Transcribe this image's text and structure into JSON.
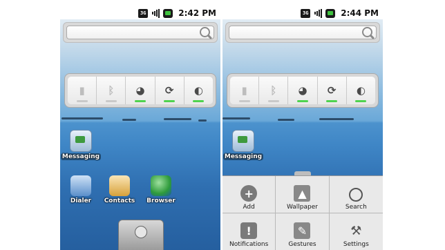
{
  "left_screen": {
    "status": {
      "network": "3G",
      "clock": "2:42 PM"
    },
    "widget": {
      "toggles": [
        {
          "icon": "wifi-toggle-icon",
          "state": "off"
        },
        {
          "icon": "bluetooth-toggle-icon",
          "state": "off"
        },
        {
          "icon": "gps-toggle-icon",
          "state": "on"
        },
        {
          "icon": "sync-toggle-icon",
          "state": "on"
        },
        {
          "icon": "brightness-toggle-icon",
          "state": "on"
        }
      ]
    },
    "shortcuts": {
      "messaging": "Messaging",
      "dialer": "Dialer",
      "contacts": "Contacts",
      "browser": "Browser"
    }
  },
  "right_screen": {
    "status": {
      "network": "3G",
      "clock": "2:44 PM"
    },
    "shortcuts": {
      "messaging": "Messaging"
    },
    "menu": {
      "items": [
        {
          "label": "Add",
          "icon": "add-icon"
        },
        {
          "label": "Wallpaper",
          "icon": "wallpaper-icon"
        },
        {
          "label": "Search",
          "icon": "search-icon"
        },
        {
          "label": "Notifications",
          "icon": "notifications-icon"
        },
        {
          "label": "Gestures",
          "icon": "gestures-icon"
        },
        {
          "label": "Settings",
          "icon": "settings-icon"
        }
      ]
    }
  },
  "colors": {
    "toggle_on": "#4fd34f",
    "toggle_off": "#c9c9c9"
  }
}
